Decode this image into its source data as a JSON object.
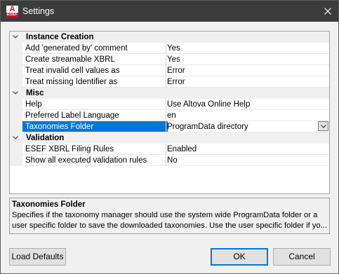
{
  "window": {
    "title": "Settings",
    "icon_letter": "A",
    "icon_label": "ESEF"
  },
  "grid": {
    "categories": [
      {
        "label": "Instance Creation",
        "properties": [
          {
            "name": "Add 'generated by' comment",
            "value": "Yes"
          },
          {
            "name": "Create streamable XBRL",
            "value": "Yes"
          },
          {
            "name": "Treat invalid cell values as",
            "value": "Error"
          },
          {
            "name": "Treat missing Identifier as",
            "value": "Error"
          }
        ]
      },
      {
        "label": "Misc",
        "properties": [
          {
            "name": "Help",
            "value": "Use Altova Online Help"
          },
          {
            "name": "Preferred Label Language",
            "value": "en"
          },
          {
            "name": "Taxonomies Folder",
            "value": "ProgramData directory"
          }
        ]
      },
      {
        "label": "Validation",
        "properties": [
          {
            "name": "ESEF XBRL Filing Rules",
            "value": "Enabled"
          },
          {
            "name": "Show all executed validation rules",
            "value": "No"
          }
        ]
      }
    ]
  },
  "description": {
    "title": "Taxonomies Folder",
    "line1": "Specifies if the taxonomy manager should use the system wide ProgramData folder or a",
    "line2": "user specific folder to save the downloaded taxonomies. Use the user specific folder if yo..."
  },
  "buttons": {
    "load_defaults": "Load Defaults",
    "ok": "OK",
    "cancel": "Cancel"
  },
  "colors": {
    "selection": "#0078d7",
    "titlebar": "#3c3c3c"
  }
}
